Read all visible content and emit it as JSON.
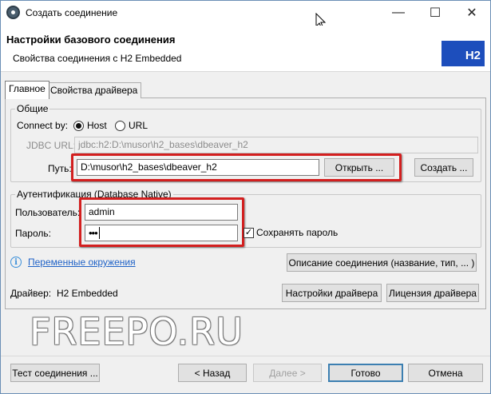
{
  "window": {
    "title": "Создать соединение",
    "minimize_glyph": "—",
    "maximize_glyph": "☐",
    "close_glyph": "✕"
  },
  "banner": {
    "title": "Настройки базового соединения",
    "subtitle": "Свойства соединения с H2 Embedded",
    "logo_text": "H2"
  },
  "tabs": [
    {
      "label": "Главное",
      "active": true
    },
    {
      "label": "Свойства драйвера",
      "active": false
    }
  ],
  "general": {
    "legend": "Общие",
    "connect_by_label": "Connect by:",
    "options": [
      {
        "label": "Host",
        "selected": true
      },
      {
        "label": "URL",
        "selected": false
      }
    ],
    "jdbc_label": "JDBC URL:",
    "jdbc_value": "jdbc:h2:D:\\musor\\h2_bases\\dbeaver_h2",
    "path_label": "Путь:",
    "path_value": "D:\\musor\\h2_bases\\dbeaver_h2",
    "open_button": "Открыть ...",
    "create_button": "Создать ..."
  },
  "auth": {
    "legend": "Аутентификация (Database Native)",
    "user_label": "Пользователь:",
    "user_value": "admin",
    "password_label": "Пароль:",
    "password_value": "•••",
    "save_password_label": "Сохранять пароль",
    "save_password_checked": true
  },
  "env": {
    "link_label": "Переменные окружения",
    "describe_button": "Описание соединения (название, тип, ... )"
  },
  "driver": {
    "label": "Драйвер:",
    "name": "H2 Embedded",
    "settings_button": "Настройки драйвера",
    "license_button": "Лицензия драйвера"
  },
  "watermark": "FREEPO.RU",
  "footer": {
    "test_button": "Тест соединения ...",
    "back_button": "< Назад",
    "next_button": "Далее >",
    "finish_button": "Готово",
    "cancel_button": "Отмена"
  },
  "colors": {
    "highlight": "#d31f1f",
    "logo_bg": "#1d4ebc",
    "link": "#1f62c7"
  }
}
